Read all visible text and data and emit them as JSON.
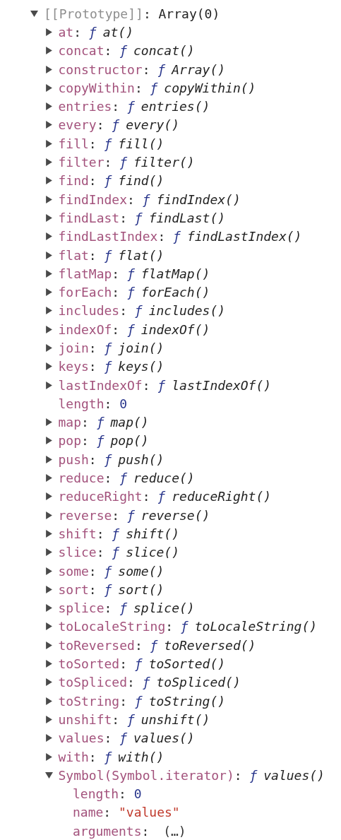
{
  "tree": {
    "key": "[[Prototype]]:",
    "kind": "internal",
    "value": "Array(0)",
    "expanded": true,
    "children": [
      {
        "key": "at:",
        "kind": "function",
        "sign": "ƒ",
        "value": "at()",
        "expanded": false
      },
      {
        "key": "concat:",
        "kind": "function",
        "sign": "ƒ",
        "value": "concat()",
        "expanded": false
      },
      {
        "key": "constructor:",
        "kind": "function",
        "sign": "ƒ",
        "value": "Array()",
        "expanded": false
      },
      {
        "key": "copyWithin:",
        "kind": "function",
        "sign": "ƒ",
        "value": "copyWithin()",
        "expanded": false
      },
      {
        "key": "entries:",
        "kind": "function",
        "sign": "ƒ",
        "value": "entries()",
        "expanded": false
      },
      {
        "key": "every:",
        "kind": "function",
        "sign": "ƒ",
        "value": "every()",
        "expanded": false
      },
      {
        "key": "fill:",
        "kind": "function",
        "sign": "ƒ",
        "value": "fill()",
        "expanded": false
      },
      {
        "key": "filter:",
        "kind": "function",
        "sign": "ƒ",
        "value": "filter()",
        "expanded": false
      },
      {
        "key": "find:",
        "kind": "function",
        "sign": "ƒ",
        "value": "find()",
        "expanded": false
      },
      {
        "key": "findIndex:",
        "kind": "function",
        "sign": "ƒ",
        "value": "findIndex()",
        "expanded": false
      },
      {
        "key": "findLast:",
        "kind": "function",
        "sign": "ƒ",
        "value": "findLast()",
        "expanded": false
      },
      {
        "key": "findLastIndex:",
        "kind": "function",
        "sign": "ƒ",
        "value": "findLastIndex()",
        "expanded": false
      },
      {
        "key": "flat:",
        "kind": "function",
        "sign": "ƒ",
        "value": "flat()",
        "expanded": false
      },
      {
        "key": "flatMap:",
        "kind": "function",
        "sign": "ƒ",
        "value": "flatMap()",
        "expanded": false
      },
      {
        "key": "forEach:",
        "kind": "function",
        "sign": "ƒ",
        "value": "forEach()",
        "expanded": false
      },
      {
        "key": "includes:",
        "kind": "function",
        "sign": "ƒ",
        "value": "includes()",
        "expanded": false
      },
      {
        "key": "indexOf:",
        "kind": "function",
        "sign": "ƒ",
        "value": "indexOf()",
        "expanded": false
      },
      {
        "key": "join:",
        "kind": "function",
        "sign": "ƒ",
        "value": "join()",
        "expanded": false
      },
      {
        "key": "keys:",
        "kind": "function",
        "sign": "ƒ",
        "value": "keys()",
        "expanded": false
      },
      {
        "key": "lastIndexOf:",
        "kind": "function",
        "sign": "ƒ",
        "value": "lastIndexOf()",
        "expanded": false
      },
      {
        "key": "length:",
        "kind": "number",
        "value": "0"
      },
      {
        "key": "map:",
        "kind": "function",
        "sign": "ƒ",
        "value": "map()",
        "expanded": false
      },
      {
        "key": "pop:",
        "kind": "function",
        "sign": "ƒ",
        "value": "pop()",
        "expanded": false
      },
      {
        "key": "push:",
        "kind": "function",
        "sign": "ƒ",
        "value": "push()",
        "expanded": false
      },
      {
        "key": "reduce:",
        "kind": "function",
        "sign": "ƒ",
        "value": "reduce()",
        "expanded": false
      },
      {
        "key": "reduceRight:",
        "kind": "function",
        "sign": "ƒ",
        "value": "reduceRight()",
        "expanded": false
      },
      {
        "key": "reverse:",
        "kind": "function",
        "sign": "ƒ",
        "value": "reverse()",
        "expanded": false
      },
      {
        "key": "shift:",
        "kind": "function",
        "sign": "ƒ",
        "value": "shift()",
        "expanded": false
      },
      {
        "key": "slice:",
        "kind": "function",
        "sign": "ƒ",
        "value": "slice()",
        "expanded": false
      },
      {
        "key": "some:",
        "kind": "function",
        "sign": "ƒ",
        "value": "some()",
        "expanded": false
      },
      {
        "key": "sort:",
        "kind": "function",
        "sign": "ƒ",
        "value": "sort()",
        "expanded": false
      },
      {
        "key": "splice:",
        "kind": "function",
        "sign": "ƒ",
        "value": "splice()",
        "expanded": false
      },
      {
        "key": "toLocaleString:",
        "kind": "function",
        "sign": "ƒ",
        "value": "toLocaleString()",
        "expanded": false
      },
      {
        "key": "toReversed:",
        "kind": "function",
        "sign": "ƒ",
        "value": "toReversed()",
        "expanded": false
      },
      {
        "key": "toSorted:",
        "kind": "function",
        "sign": "ƒ",
        "value": "toSorted()",
        "expanded": false
      },
      {
        "key": "toSpliced:",
        "kind": "function",
        "sign": "ƒ",
        "value": "toSpliced()",
        "expanded": false
      },
      {
        "key": "toString:",
        "kind": "function",
        "sign": "ƒ",
        "value": "toString()",
        "expanded": false
      },
      {
        "key": "unshift:",
        "kind": "function",
        "sign": "ƒ",
        "value": "unshift()",
        "expanded": false
      },
      {
        "key": "values:",
        "kind": "function",
        "sign": "ƒ",
        "value": "values()",
        "expanded": false
      },
      {
        "key": "with:",
        "kind": "function",
        "sign": "ƒ",
        "value": "with()",
        "expanded": false
      },
      {
        "key": "Symbol(Symbol.iterator):",
        "kind": "function",
        "sign": "ƒ",
        "value": "values()",
        "expanded": true,
        "children": [
          {
            "key": "length:",
            "kind": "number",
            "value": "0"
          },
          {
            "key": "name:",
            "kind": "string",
            "value": "\"values\""
          },
          {
            "key": "arguments:",
            "kind": "lazy",
            "value": "(…)"
          }
        ]
      }
    ]
  }
}
